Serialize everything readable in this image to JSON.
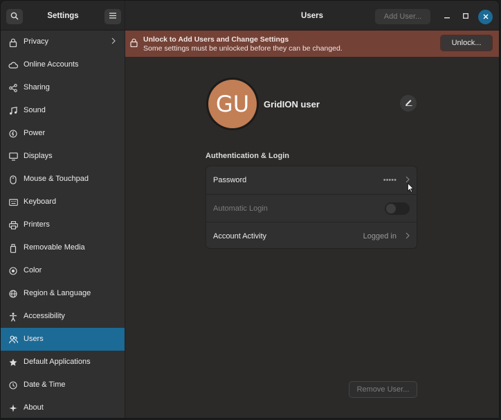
{
  "header": {
    "sidebar_title": "Settings",
    "main_title": "Users",
    "add_user_label": "Add User..."
  },
  "sidebar": {
    "items": [
      {
        "label": "Privacy",
        "icon": "lock-icon"
      },
      {
        "label": "Online Accounts",
        "icon": "cloud-icon"
      },
      {
        "label": "Sharing",
        "icon": "share-icon"
      },
      {
        "label": "Sound",
        "icon": "music-note-icon"
      },
      {
        "label": "Power",
        "icon": "power-icon"
      },
      {
        "label": "Displays",
        "icon": "display-icon"
      },
      {
        "label": "Mouse & Touchpad",
        "icon": "mouse-icon"
      },
      {
        "label": "Keyboard",
        "icon": "keyboard-icon"
      },
      {
        "label": "Printers",
        "icon": "printer-icon"
      },
      {
        "label": "Removable Media",
        "icon": "usb-drive-icon"
      },
      {
        "label": "Color",
        "icon": "color-palette-icon"
      },
      {
        "label": "Region & Language",
        "icon": "globe-icon"
      },
      {
        "label": "Accessibility",
        "icon": "accessibility-icon"
      },
      {
        "label": "Users",
        "icon": "users-icon",
        "active": true
      },
      {
        "label": "Default Applications",
        "icon": "star-icon"
      },
      {
        "label": "Date & Time",
        "icon": "clock-icon"
      },
      {
        "label": "About",
        "icon": "sparkle-icon"
      }
    ]
  },
  "banner": {
    "title": "Unlock to Add Users and Change Settings",
    "subtitle": "Some settings must be unlocked before they can be changed.",
    "unlock_label": "Unlock..."
  },
  "user": {
    "initials": "GU",
    "name": "GridION user"
  },
  "auth": {
    "section_title": "Authentication & Login",
    "password_label": "Password",
    "password_value": "•••••",
    "auto_login_label": "Automatic Login",
    "auto_login_enabled": false,
    "account_activity_label": "Account Activity",
    "account_activity_value": "Logged in"
  },
  "remove_user_label": "Remove User...",
  "colors": {
    "accent": "#1c6a96",
    "banner": "#734136",
    "avatar": "#c27e55"
  }
}
